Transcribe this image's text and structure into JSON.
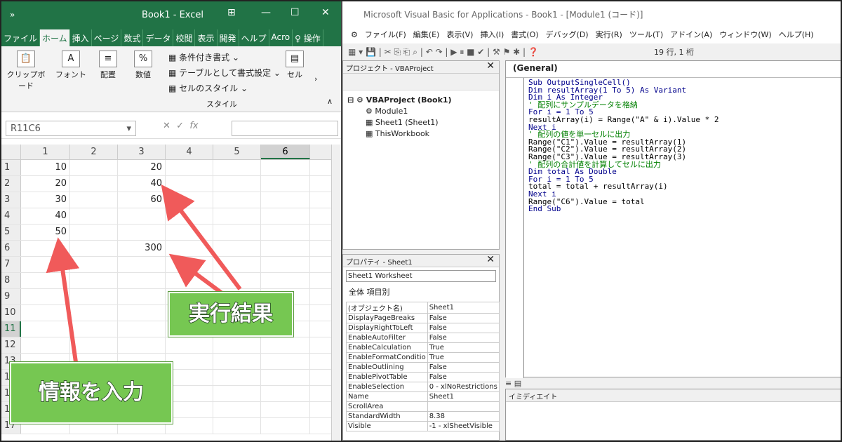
{
  "excel": {
    "title": "Book1 - Excel",
    "qa": "»",
    "menu": [
      "ファイル",
      "ホーム",
      "挿入",
      "ページ",
      "数式",
      "データ",
      "校閲",
      "表示",
      "開発",
      "ヘルプ",
      "Acro",
      "操作"
    ],
    "ribbon": {
      "clipboard": "クリップボード",
      "font": "フォント",
      "align": "配置",
      "number": "数値",
      "cond": "条件付き書式 ⌄",
      "table": "テーブルとして書式設定 ⌄",
      "cellstyle": "セルのスタイル ⌄",
      "style": "スタイル",
      "cells": "セル"
    },
    "namebox": "R11C6",
    "fx": "fx",
    "col_headers": [
      "1",
      "2",
      "3",
      "4",
      "5",
      "6"
    ],
    "rows": [
      {
        "n": "1",
        "c1": "10",
        "c3": "20"
      },
      {
        "n": "2",
        "c1": "20",
        "c3": "40"
      },
      {
        "n": "3",
        "c1": "30",
        "c3": "60"
      },
      {
        "n": "4",
        "c1": "40",
        "c3": ""
      },
      {
        "n": "5",
        "c1": "50",
        "c3": ""
      },
      {
        "n": "6",
        "c1": "",
        "c3": "300"
      },
      {
        "n": "7",
        "c1": "",
        "c3": ""
      },
      {
        "n": "8",
        "c1": "",
        "c3": ""
      },
      {
        "n": "9",
        "c1": "",
        "c3": ""
      },
      {
        "n": "10",
        "c1": "",
        "c3": ""
      },
      {
        "n": "11",
        "c1": "",
        "c3": ""
      },
      {
        "n": "12",
        "c1": "",
        "c3": ""
      },
      {
        "n": "13",
        "c1": "",
        "c3": ""
      },
      {
        "n": "14",
        "c1": "",
        "c3": ""
      },
      {
        "n": "15",
        "c1": "",
        "c3": ""
      },
      {
        "n": "16",
        "c1": "",
        "c3": ""
      },
      {
        "n": "17",
        "c1": "",
        "c3": ""
      }
    ]
  },
  "vbe": {
    "title": "Microsoft Visual Basic for Applications - Book1 - [Module1 (コード)]",
    "menu": [
      "ファイル(F)",
      "編集(E)",
      "表示(V)",
      "挿入(I)",
      "書式(O)",
      "デバッグ(D)",
      "実行(R)",
      "ツール(T)",
      "アドイン(A)",
      "ウィンドウ(W)",
      "ヘルプ(H)"
    ],
    "position": "19 行, 1 桁",
    "project_title": "プロジェクト - VBAProject",
    "tree": [
      "VBAProject (Book1)",
      "Module1",
      "Sheet1 (Sheet1)",
      "ThisWorkbook"
    ],
    "props_title": "プロパティ - Sheet1",
    "props_select": "Sheet1 Worksheet",
    "props_tabs": "全体   項目別",
    "props": [
      [
        "(オブジェクト名)",
        "Sheet1"
      ],
      [
        "DisplayPageBreaks",
        "False"
      ],
      [
        "DisplayRightToLeft",
        "False"
      ],
      [
        "EnableAutoFilter",
        "False"
      ],
      [
        "EnableCalculation",
        "True"
      ],
      [
        "EnableFormatConditio",
        "True"
      ],
      [
        "EnableOutlining",
        "False"
      ],
      [
        "EnablePivotTable",
        "False"
      ],
      [
        "EnableSelection",
        "0 - xlNoRestrictions"
      ],
      [
        "Name",
        "Sheet1"
      ],
      [
        "ScrollArea",
        ""
      ],
      [
        "StandardWidth",
        "8.38"
      ],
      [
        "Visible",
        "-1 - xlSheetVisible"
      ]
    ],
    "code_header": "(General)",
    "code": [
      [
        "kw",
        "Sub OutputSingleCell()"
      ],
      [
        "kw",
        "Dim resultArray(1 To 5) As Variant"
      ],
      [
        "kw",
        "Dim i As Integer"
      ],
      [
        "cm",
        "' 配列にサンプルデータを格納"
      ],
      [
        "kw",
        "For i = 1 To 5"
      ],
      [
        "tx",
        "resultArray(i) = Range(\"A\" & i).Value * 2"
      ],
      [
        "kw",
        "Next i"
      ],
      [
        "cm",
        "' 配列の値を単一セルに出力"
      ],
      [
        "tx",
        "Range(\"C1\").Value = resultArray(1)"
      ],
      [
        "tx",
        "Range(\"C2\").Value = resultArray(2)"
      ],
      [
        "tx",
        "Range(\"C3\").Value = resultArray(3)"
      ],
      [
        "cm",
        "' 配列の合計値を計算してセルに出力"
      ],
      [
        "kw",
        "Dim total As Double"
      ],
      [
        "kw",
        "For i = 1 To 5"
      ],
      [
        "tx",
        "total = total + resultArray(i)"
      ],
      [
        "kw",
        "Next i"
      ],
      [
        "tx",
        "Range(\"C6\").Value = total"
      ],
      [
        "kw",
        "End Sub"
      ]
    ],
    "immediate_title": "イミディエイト"
  },
  "callouts": {
    "result": "実行結果",
    "input": "情報を入力"
  },
  "colors": {
    "excel_green": "#217346",
    "callout_green": "#76c752",
    "arrow": "#f05a5a"
  }
}
